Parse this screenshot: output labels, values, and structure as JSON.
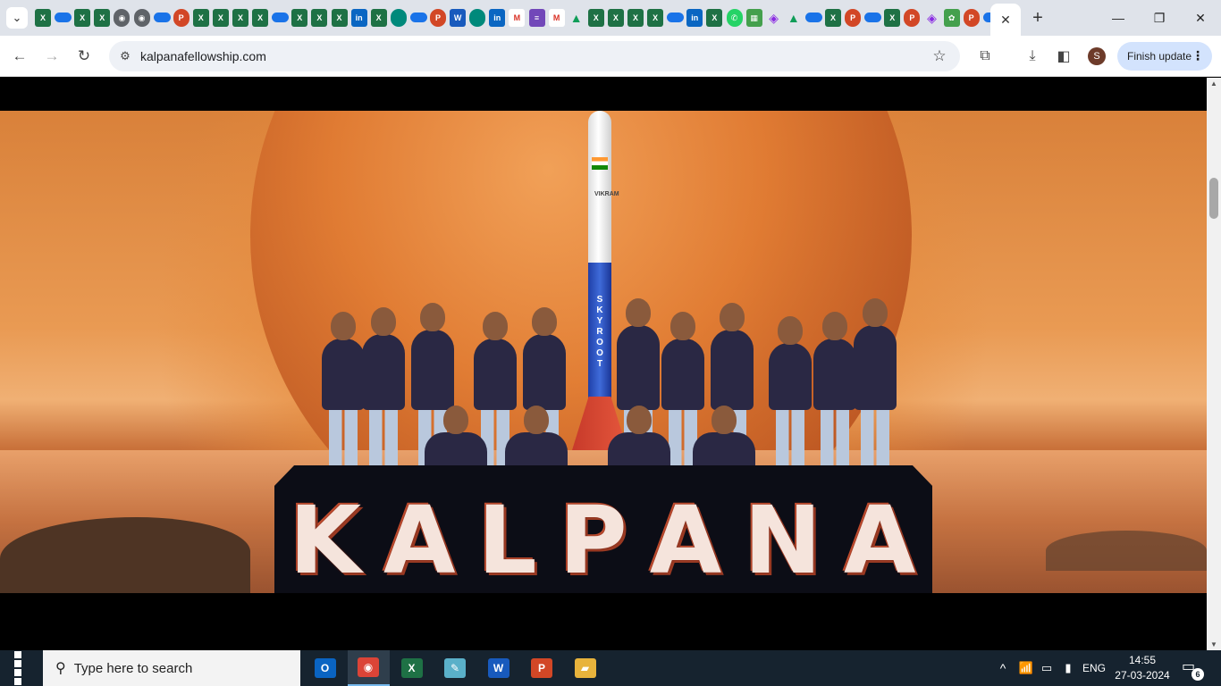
{
  "browser": {
    "tab_search_icon": "chevron-down-icon",
    "mini_tabs": [
      {
        "type": "e",
        "glyph": "X"
      },
      {
        "type": "od",
        "glyph": ""
      },
      {
        "type": "e",
        "glyph": "X"
      },
      {
        "type": "e",
        "glyph": "X"
      },
      {
        "type": "g",
        "glyph": "◉"
      },
      {
        "type": "g",
        "glyph": "◉"
      },
      {
        "type": "od",
        "glyph": ""
      },
      {
        "type": "p",
        "glyph": "P"
      },
      {
        "type": "e",
        "glyph": "X"
      },
      {
        "type": "e",
        "glyph": "X"
      },
      {
        "type": "e",
        "glyph": "X"
      },
      {
        "type": "e",
        "glyph": "X"
      },
      {
        "type": "od",
        "glyph": ""
      },
      {
        "type": "e",
        "glyph": "X"
      },
      {
        "type": "e",
        "glyph": "X"
      },
      {
        "type": "e",
        "glyph": "X"
      },
      {
        "type": "li",
        "glyph": "in"
      },
      {
        "type": "e",
        "glyph": "X"
      },
      {
        "type": "cl",
        "glyph": ""
      },
      {
        "type": "od",
        "glyph": ""
      },
      {
        "type": "p",
        "glyph": "P"
      },
      {
        "type": "w",
        "glyph": "W"
      },
      {
        "type": "cl",
        "glyph": ""
      },
      {
        "type": "li",
        "glyph": "in"
      },
      {
        "type": "gm",
        "glyph": "M"
      },
      {
        "type": "fm",
        "glyph": "≡"
      },
      {
        "type": "gm",
        "glyph": "M"
      },
      {
        "type": "dr",
        "glyph": "▲"
      },
      {
        "type": "e",
        "glyph": "X"
      },
      {
        "type": "e",
        "glyph": "X"
      },
      {
        "type": "e",
        "glyph": "X"
      },
      {
        "type": "e",
        "glyph": "X"
      },
      {
        "type": "od",
        "glyph": ""
      },
      {
        "type": "li",
        "glyph": "in"
      },
      {
        "type": "e",
        "glyph": "X"
      },
      {
        "type": "wa",
        "glyph": "✆"
      },
      {
        "type": "sk",
        "glyph": "▦"
      },
      {
        "type": "gr",
        "glyph": "◈"
      },
      {
        "type": "dr",
        "glyph": "▲"
      },
      {
        "type": "od",
        "glyph": ""
      },
      {
        "type": "e",
        "glyph": "X"
      },
      {
        "type": "p",
        "glyph": "P"
      },
      {
        "type": "od",
        "glyph": ""
      },
      {
        "type": "e",
        "glyph": "X"
      },
      {
        "type": "p",
        "glyph": "P"
      },
      {
        "type": "gr",
        "glyph": "◈"
      },
      {
        "type": "sk",
        "glyph": "✿"
      },
      {
        "type": "p",
        "glyph": "P"
      },
      {
        "type": "od",
        "glyph": ""
      }
    ],
    "active_tab_close": "✕",
    "new_tab": "+",
    "window_controls": {
      "minimize": "—",
      "restore": "❐",
      "close": "✕"
    },
    "nav": {
      "back": "←",
      "forward": "→",
      "reload": "↻"
    },
    "url": "kalpanafellowship.com",
    "bookmark_icon": "☆",
    "avatar_letter": "S",
    "finish_update": "Finish update",
    "menu_dots": "⋮"
  },
  "hero": {
    "rocket_flag_text": "VIKRAM",
    "rocket_brand": "SKYROOT",
    "logo_letters": [
      "K",
      "A",
      "L",
      "P",
      "A",
      "N",
      "A"
    ]
  },
  "taskbar": {
    "search_placeholder": "Type here to search",
    "apps": [
      {
        "name": "outlook",
        "glyph": "O",
        "color": "#0a64c2"
      },
      {
        "name": "chrome",
        "glyph": "◉",
        "color": "#db4437"
      },
      {
        "name": "excel",
        "glyph": "X",
        "color": "#1e7145"
      },
      {
        "name": "snip",
        "glyph": "✎",
        "color": "#5ab0c9"
      },
      {
        "name": "word",
        "glyph": "W",
        "color": "#185abd"
      },
      {
        "name": "powerpoint",
        "glyph": "P",
        "color": "#d24726"
      },
      {
        "name": "file-explorer",
        "glyph": "▰",
        "color": "#e8b33c"
      }
    ],
    "tray_chevron": "^",
    "language": "ENG",
    "time": "14:55",
    "date": "27-03-2024",
    "notification_count": "6"
  }
}
